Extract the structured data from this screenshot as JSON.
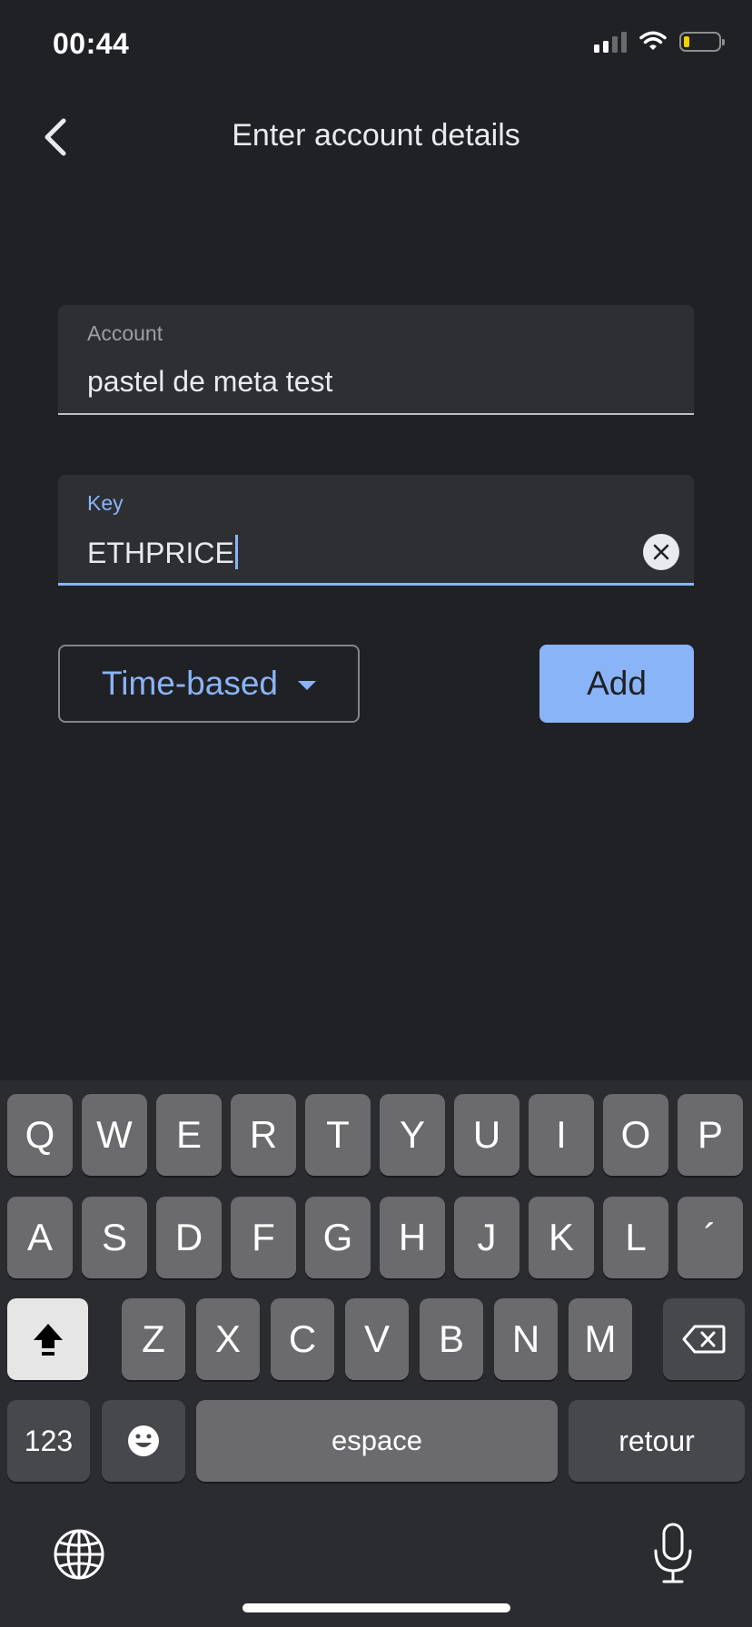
{
  "status_bar": {
    "time": "00:44",
    "battery_color": "#f4d000"
  },
  "app_bar": {
    "back_icon": "chevron-left-icon",
    "title": "Enter account details"
  },
  "account_field": {
    "label": "Account",
    "value": "pastel de meta test"
  },
  "key_field": {
    "label": "Key",
    "value": "ETHPRICE",
    "clear_icon": "clear-circle-icon"
  },
  "type_select": {
    "selected": "Time-based",
    "icon": "dropdown-caret-icon"
  },
  "add_button": {
    "label": "Add"
  },
  "colors": {
    "accent": "#8ab4f8",
    "background": "#202124",
    "field_bg": "#2e2f33"
  },
  "keyboard": {
    "row1": [
      "Q",
      "W",
      "E",
      "R",
      "T",
      "Y",
      "U",
      "I",
      "O",
      "P"
    ],
    "row2": [
      "A",
      "S",
      "D",
      "F",
      "G",
      "H",
      "J",
      "K",
      "L",
      "´"
    ],
    "row3": [
      "Z",
      "X",
      "C",
      "V",
      "B",
      "N",
      "M"
    ],
    "numbers_label": "123",
    "space_label": "espace",
    "return_label": "retour",
    "icons": [
      "shift-icon",
      "backspace-icon",
      "emoji-icon",
      "globe-icon",
      "microphone-icon"
    ]
  }
}
